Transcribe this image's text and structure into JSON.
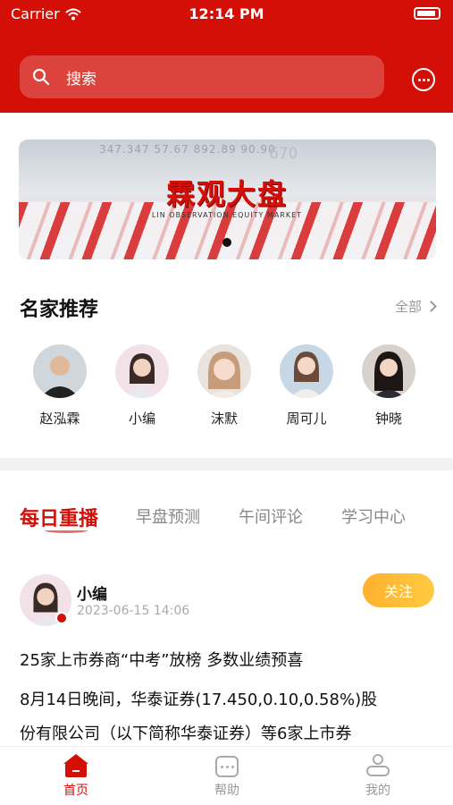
{
  "status": {
    "carrier": "Carrier",
    "time": "12:14 PM"
  },
  "search": {
    "placeholder": "搜索"
  },
  "banner": {
    "ticker": "347.347   57.67   892.89   90.90",
    "ticker_big": "670",
    "title_cn": "霖观大盘",
    "title_en": "LIN OBSERVATION EQUITY MARKET"
  },
  "experts": {
    "title": "名家推荐",
    "all_label": "全部",
    "items": [
      {
        "name": "赵泓霖"
      },
      {
        "name": "小编"
      },
      {
        "name": "沫默"
      },
      {
        "name": "周可儿"
      },
      {
        "name": "钟晓"
      }
    ]
  },
  "tabs": [
    {
      "label": "每日重播",
      "active": true
    },
    {
      "label": "早盘预测",
      "active": false
    },
    {
      "label": "午间评论",
      "active": false
    },
    {
      "label": "学习中心",
      "active": false
    }
  ],
  "post": {
    "author": "小编",
    "time": "2023-06-15 14:06",
    "follow_label": "关注",
    "title": "25家上市券商“中考”放榜 多数业绩预喜",
    "body_line1": "8月14日晚间，华泰证券(17.450,0.10,0.58%)股",
    "body_line2": "份有限公司（以下简称华泰证券）等6家上市券"
  },
  "tabbar": [
    {
      "label": "首页",
      "icon": "home-icon",
      "active": true
    },
    {
      "label": "帮助",
      "icon": "chat-help-icon",
      "active": false
    },
    {
      "label": "我的",
      "icon": "profile-icon",
      "active": false
    }
  ],
  "colors": {
    "brand": "#d40f07",
    "follow": "#ffb02e"
  }
}
